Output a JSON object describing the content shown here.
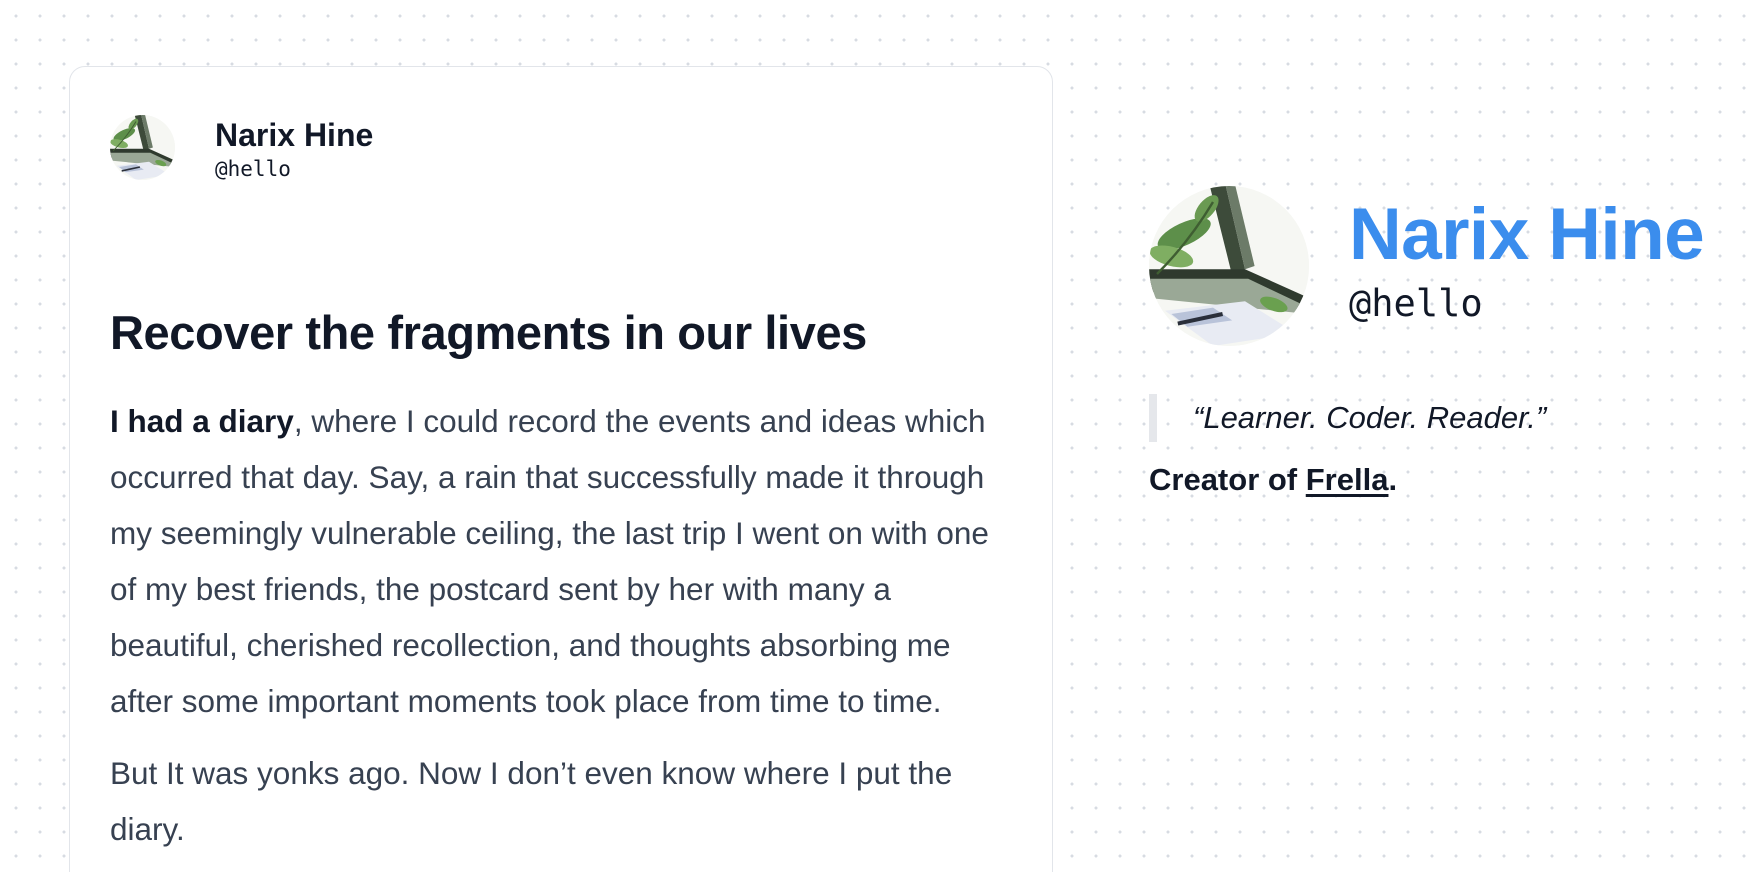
{
  "post": {
    "author_name": "Narix Hine",
    "author_handle": "@hello",
    "title": "Recover the fragments in our lives",
    "p1_bold": "I had a diary",
    "p1_rest": ", where I could record the events and ideas which occurred that day. Say, a rain that successfully made it through my seemingly vulnerable ceiling, the last trip I went on with one of my best friends, the postcard sent by her with many a beautiful, cherished recollection, and thoughts absorbing me after some important moments took place from time to time.",
    "p2": "But It was yonks ago. Now I don’t even know where I put the diary."
  },
  "profile": {
    "name": "Narix Hine",
    "handle": "@hello",
    "quote": "“Learner. Coder. Reader.”",
    "creator_prefix": "Creator of ",
    "creator_link": "Frella",
    "creator_suffix": "."
  },
  "colors": {
    "accent": "#3b8ded",
    "text": "#111827",
    "body_text": "#374151",
    "card_border": "#e2e5ea",
    "quote_bar": "#e5e7eb"
  },
  "icons": {
    "avatar": "watercolor-window-sill-illustration"
  }
}
